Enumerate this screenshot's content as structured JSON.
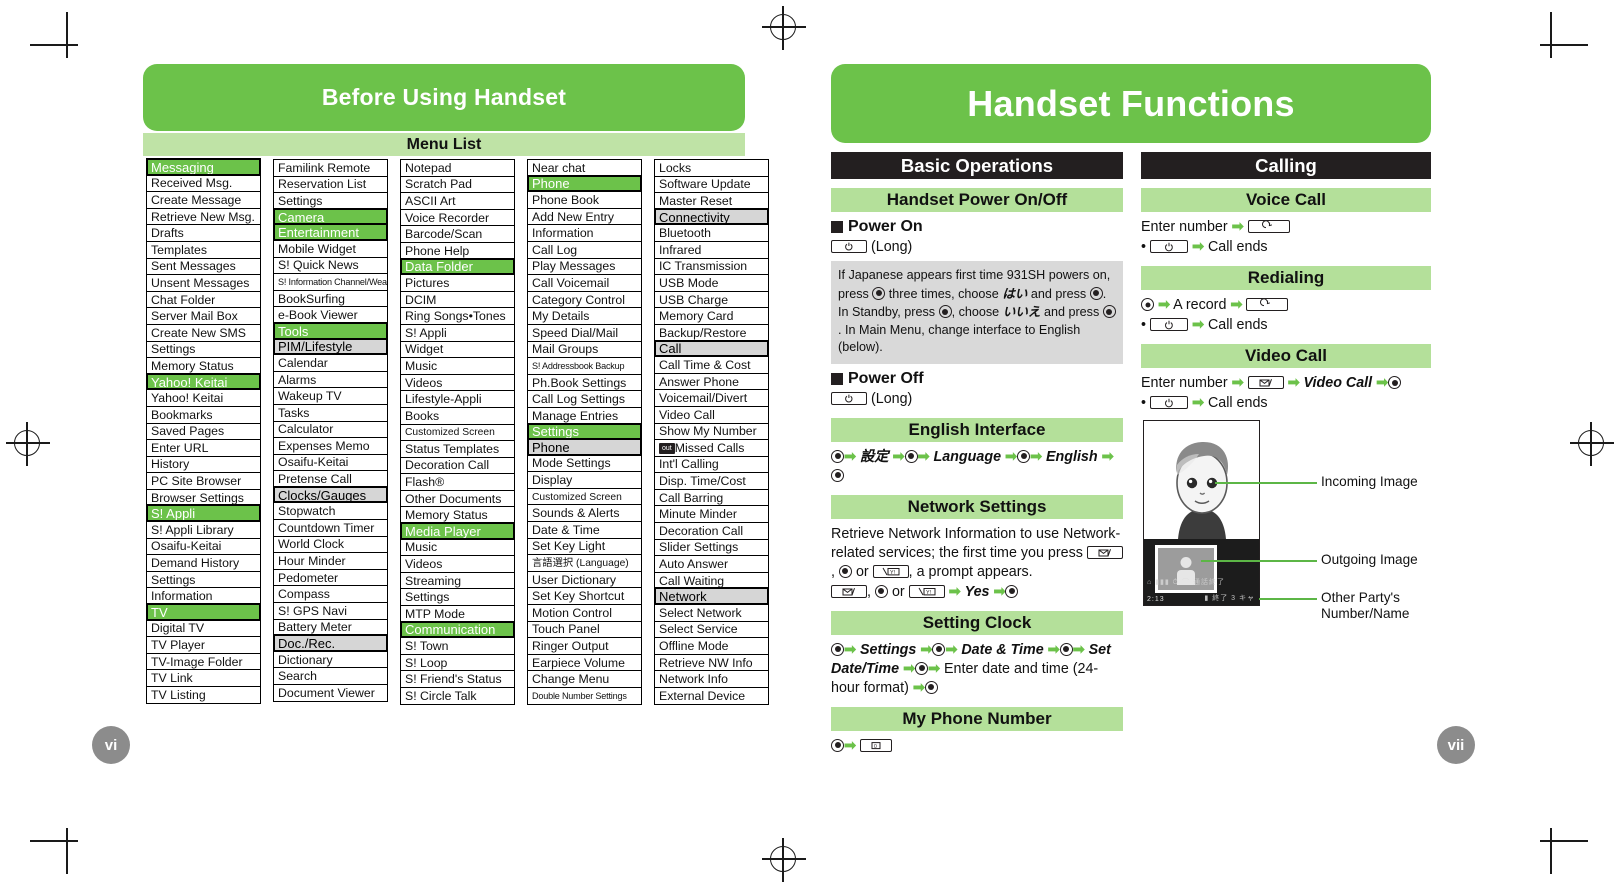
{
  "left_page": {
    "banner_title": "Before Using Handset",
    "section_title": "Menu List",
    "page_number": "vi",
    "menu_columns": [
      [
        {
          "t": "Messaging",
          "lvl": 1
        },
        {
          "t": "Received Msg.",
          "lvl": 3
        },
        {
          "t": "Create Message",
          "lvl": 3
        },
        {
          "t": "Retrieve New Msg.",
          "lvl": 3
        },
        {
          "t": "Drafts",
          "lvl": 3
        },
        {
          "t": "Templates",
          "lvl": 3
        },
        {
          "t": "Sent Messages",
          "lvl": 3
        },
        {
          "t": "Unsent Messages",
          "lvl": 3
        },
        {
          "t": "Chat Folder",
          "lvl": 3
        },
        {
          "t": "Server Mail Box",
          "lvl": 3
        },
        {
          "t": "Create New SMS",
          "lvl": 3
        },
        {
          "t": "Settings",
          "lvl": 3
        },
        {
          "t": "Memory Status",
          "lvl": 3
        },
        {
          "t": "Yahoo! Keitai",
          "lvl": 1
        },
        {
          "t": "Yahoo! Keitai",
          "lvl": 3
        },
        {
          "t": "Bookmarks",
          "lvl": 3
        },
        {
          "t": "Saved Pages",
          "lvl": 3
        },
        {
          "t": "Enter URL",
          "lvl": 3
        },
        {
          "t": "History",
          "lvl": 3
        },
        {
          "t": "PC Site Browser",
          "lvl": 3
        },
        {
          "t": "Browser Settings",
          "lvl": 3
        },
        {
          "t": "S! Appli",
          "lvl": 1
        },
        {
          "t": "S! Appli Library",
          "lvl": 3
        },
        {
          "t": "Osaifu-Keitai",
          "lvl": 3
        },
        {
          "t": "Demand History",
          "lvl": 3
        },
        {
          "t": "Settings",
          "lvl": 3
        },
        {
          "t": "Information",
          "lvl": 3
        },
        {
          "t": "TV",
          "lvl": 1
        },
        {
          "t": "Digital TV",
          "lvl": 3
        },
        {
          "t": "TV Player",
          "lvl": 3
        },
        {
          "t": "TV-Image Folder",
          "lvl": 3
        },
        {
          "t": "TV Link",
          "lvl": 3
        },
        {
          "t": "TV Listing",
          "lvl": 3
        }
      ],
      [
        {
          "t": "Familink Remote",
          "lvl": 3
        },
        {
          "t": "Reservation List",
          "lvl": 3
        },
        {
          "t": "Settings",
          "lvl": 3
        },
        {
          "t": "Camera",
          "lvl": 1
        },
        {
          "t": "Entertainment",
          "lvl": 1
        },
        {
          "t": "Mobile Widget",
          "lvl": 3
        },
        {
          "t": "S! Quick News",
          "lvl": 3
        },
        {
          "t": "S! Information Channel/Weather",
          "lvl": 3,
          "sz": "tiny"
        },
        {
          "t": "BookSurfing",
          "lvl": 3
        },
        {
          "t": "e-Book Viewer",
          "lvl": 3
        },
        {
          "t": "Tools",
          "lvl": 1
        },
        {
          "t": "PIM/Lifestyle",
          "lvl": 2
        },
        {
          "t": "Calendar",
          "lvl": 3
        },
        {
          "t": "Alarms",
          "lvl": 3
        },
        {
          "t": "Wakeup TV",
          "lvl": 3
        },
        {
          "t": "Tasks",
          "lvl": 3
        },
        {
          "t": "Calculator",
          "lvl": 3
        },
        {
          "t": "Expenses Memo",
          "lvl": 3
        },
        {
          "t": "Osaifu-Keitai",
          "lvl": 3
        },
        {
          "t": "Pretense Call",
          "lvl": 3
        },
        {
          "t": "Clocks/Gauges",
          "lvl": 2
        },
        {
          "t": "Stopwatch",
          "lvl": 3
        },
        {
          "t": "Countdown Timer",
          "lvl": 3
        },
        {
          "t": "World Clock",
          "lvl": 3
        },
        {
          "t": "Hour Minder",
          "lvl": 3
        },
        {
          "t": "Pedometer",
          "lvl": 3
        },
        {
          "t": "Compass",
          "lvl": 3
        },
        {
          "t": "S! GPS Navi",
          "lvl": 3
        },
        {
          "t": "Battery Meter",
          "lvl": 3
        },
        {
          "t": "Doc./Rec.",
          "lvl": 2
        },
        {
          "t": "Dictionary",
          "lvl": 3
        },
        {
          "t": "Search",
          "lvl": 3
        },
        {
          "t": "Document Viewer",
          "lvl": 3
        }
      ],
      [
        {
          "t": "Notepad",
          "lvl": 3
        },
        {
          "t": "Scratch Pad",
          "lvl": 3
        },
        {
          "t": "ASCII Art",
          "lvl": 3
        },
        {
          "t": "Voice Recorder",
          "lvl": 3
        },
        {
          "t": "Barcode/Scan",
          "lvl": 3
        },
        {
          "t": "Phone Help",
          "lvl": 3
        },
        {
          "t": "Data Folder",
          "lvl": 1
        },
        {
          "t": "Pictures",
          "lvl": 3
        },
        {
          "t": "DCIM",
          "lvl": 3
        },
        {
          "t": "Ring Songs•Tones",
          "lvl": 3
        },
        {
          "t": "S! Appli",
          "lvl": 3
        },
        {
          "t": "Widget",
          "lvl": 3
        },
        {
          "t": "Music",
          "lvl": 3
        },
        {
          "t": "Videos",
          "lvl": 3
        },
        {
          "t": "Lifestyle-Appli",
          "lvl": 3
        },
        {
          "t": "Books",
          "lvl": 3
        },
        {
          "t": "Customized Screen",
          "lvl": 3,
          "sz": "small"
        },
        {
          "t": "Status Templates",
          "lvl": 3
        },
        {
          "t": "Decoration Call",
          "lvl": 3
        },
        {
          "t": "Flash®",
          "lvl": 3
        },
        {
          "t": "Other Documents",
          "lvl": 3
        },
        {
          "t": "Memory Status",
          "lvl": 3
        },
        {
          "t": "Media Player",
          "lvl": 1
        },
        {
          "t": "Music",
          "lvl": 3
        },
        {
          "t": "Videos",
          "lvl": 3
        },
        {
          "t": "Streaming",
          "lvl": 3
        },
        {
          "t": "Settings",
          "lvl": 3
        },
        {
          "t": "MTP Mode",
          "lvl": 3
        },
        {
          "t": "Communication",
          "lvl": 1
        },
        {
          "t": "S! Town",
          "lvl": 3
        },
        {
          "t": "S! Loop",
          "lvl": 3
        },
        {
          "t": "S! Friend's Status",
          "lvl": 3
        },
        {
          "t": "S! Circle Talk",
          "lvl": 3
        }
      ],
      [
        {
          "t": "Near chat",
          "lvl": 3
        },
        {
          "t": "Phone",
          "lvl": 1
        },
        {
          "t": "Phone Book",
          "lvl": 3
        },
        {
          "t": "Add New Entry",
          "lvl": 3
        },
        {
          "t": "Information",
          "lvl": 3
        },
        {
          "t": "Call Log",
          "lvl": 3
        },
        {
          "t": "Play Messages",
          "lvl": 3
        },
        {
          "t": "Call Voicemail",
          "lvl": 3
        },
        {
          "t": "Category Control",
          "lvl": 3
        },
        {
          "t": "My Details",
          "lvl": 3
        },
        {
          "t": "Speed Dial/Mail",
          "lvl": 3
        },
        {
          "t": "Mail Groups",
          "lvl": 3
        },
        {
          "t": "S! Addressbook Backup",
          "lvl": 3,
          "sz": "tiny"
        },
        {
          "t": "Ph.Book Settings",
          "lvl": 3
        },
        {
          "t": "Call Log Settings",
          "lvl": 3
        },
        {
          "t": "Manage Entries",
          "lvl": 3
        },
        {
          "t": "Settings",
          "lvl": 1
        },
        {
          "t": "Phone",
          "lvl": 2
        },
        {
          "t": "Mode Settings",
          "lvl": 3
        },
        {
          "t": "Display",
          "lvl": 3
        },
        {
          "t": "Customized Screen",
          "lvl": 3,
          "sz": "small"
        },
        {
          "t": "Sounds & Alerts",
          "lvl": 3
        },
        {
          "t": "Date & Time",
          "lvl": 3
        },
        {
          "t": "Set Key Light",
          "lvl": 3
        },
        {
          "t": "言語選択 (Language)",
          "lvl": 3,
          "sz": "small"
        },
        {
          "t": "User Dictionary",
          "lvl": 3
        },
        {
          "t": "Set Key Shortcut",
          "lvl": 3
        },
        {
          "t": "Motion Control",
          "lvl": 3
        },
        {
          "t": "Touch Panel",
          "lvl": 3
        },
        {
          "t": "Ringer Output",
          "lvl": 3
        },
        {
          "t": "Earpiece Volume",
          "lvl": 3
        },
        {
          "t": "Change Menu",
          "lvl": 3
        },
        {
          "t": "Double Number Settings",
          "lvl": 3,
          "sz": "tiny"
        }
      ],
      [
        {
          "t": "Locks",
          "lvl": 3
        },
        {
          "t": "Software Update",
          "lvl": 3
        },
        {
          "t": "Master Reset",
          "lvl": 3
        },
        {
          "t": "Connectivity",
          "lvl": 2
        },
        {
          "t": "Bluetooth",
          "lvl": 3
        },
        {
          "t": "Infrared",
          "lvl": 3
        },
        {
          "t": "IC Transmission",
          "lvl": 3
        },
        {
          "t": "USB Mode",
          "lvl": 3
        },
        {
          "t": "USB Charge",
          "lvl": 3
        },
        {
          "t": "Memory Card",
          "lvl": 3
        },
        {
          "t": "Backup/Restore",
          "lvl": 3
        },
        {
          "t": "Call",
          "lvl": 2
        },
        {
          "t": "Call Time & Cost",
          "lvl": 3
        },
        {
          "t": "Answer Phone",
          "lvl": 3
        },
        {
          "t": "Voicemail/Divert",
          "lvl": 3
        },
        {
          "t": "Video Call",
          "lvl": 3
        },
        {
          "t": "Show My Number",
          "lvl": 3
        },
        {
          "t": "Missed Calls",
          "lvl": 3,
          "icon": "out-badge-icon"
        },
        {
          "t": "Int'l Calling",
          "lvl": 3
        },
        {
          "t": "Disp. Time/Cost",
          "lvl": 3
        },
        {
          "t": "Call Barring",
          "lvl": 3
        },
        {
          "t": "Minute Minder",
          "lvl": 3
        },
        {
          "t": "Decoration Call",
          "lvl": 3
        },
        {
          "t": "Slider Settings",
          "lvl": 3
        },
        {
          "t": "Auto Answer",
          "lvl": 3
        },
        {
          "t": "Call Waiting",
          "lvl": 3
        },
        {
          "t": "Network",
          "lvl": 2
        },
        {
          "t": "Select Network",
          "lvl": 3
        },
        {
          "t": "Select Service",
          "lvl": 3
        },
        {
          "t": "Offline Mode",
          "lvl": 3
        },
        {
          "t": "Retrieve NW Info",
          "lvl": 3
        },
        {
          "t": "Network Info",
          "lvl": 3
        },
        {
          "t": "External Device",
          "lvl": 3
        }
      ]
    ]
  },
  "right_page": {
    "banner_title": "Handset Functions",
    "page_number": "vii",
    "basic_operations": {
      "title": "Basic Operations",
      "power": {
        "header": "Handset Power On/Off",
        "power_on_label": "Power On",
        "power_on_key": "(Long)",
        "note": "If Japanese appears first time 931SH powers on, press ⊙ three times, choose はい and press ⊙. In Standby, press ⊙, choose いいえ and press ⊙. In Main Menu, change interface to English (below).",
        "note_parts": {
          "p1": "If Japanese appears first time 931SH powers on, press",
          "p2": "three times, choose",
          "jp_yes": "はい",
          "p3": "and press",
          "p4": ". In Standby, press",
          "p5": ", choose",
          "jp_no": "いいえ",
          "p6": "and press",
          "p7": ". In Main Menu, change interface to English (below)."
        },
        "power_off_label": "Power Off",
        "power_off_key": "(Long)"
      },
      "english_interface": {
        "header": "English Interface",
        "step_jp": "設定",
        "step_language": "Language",
        "step_english": "English"
      },
      "network_settings": {
        "header": "Network Settings",
        "body_1": "Retrieve Network Information to use Network-related services; the first time you press",
        "body_2": "or",
        "body_3": ", a prompt appears.",
        "step_or": "or",
        "step_yes": "Yes"
      },
      "setting_clock": {
        "header": "Setting Clock",
        "step_settings": "Settings",
        "step_datetime": "Date & Time",
        "step_setdatetime": "Set Date/Time",
        "step_enter": "Enter date and time (24-hour format)"
      },
      "my_phone_number": {
        "header": "My Phone Number"
      }
    },
    "calling": {
      "title": "Calling",
      "voice_call": {
        "header": "Voice Call",
        "step_enter": "Enter number",
        "bullet_end": "Call ends"
      },
      "redialing": {
        "header": "Redialing",
        "step_record": "A record",
        "bullet_end": "Call ends"
      },
      "video_call": {
        "header": "Video Call",
        "step_enter": "Enter number",
        "step_video": "Video Call",
        "bullet_end": "Call ends"
      },
      "figure": {
        "callout_incoming": "Incoming Image",
        "callout_outgoing": "Outgoing Image",
        "callout_other_line1": "Other Party's",
        "callout_other_line2": "Number/Name",
        "status_time": "2:13",
        "status_icons_row1": "⌂ ▮▮▮  ⏱  ⌒ 通話終了",
        "status_icons_row2": "▮ 終了  3 キャ"
      }
    }
  },
  "colors": {
    "brand_green": "#6cc24a",
    "light_green": "#b4e09a",
    "pale_green": "#bfe3a6",
    "dark": "#231f20",
    "grey_header": "#d6d6d6",
    "note_grey": "#d9d9d9",
    "page_badge": "#8c8c8c"
  }
}
